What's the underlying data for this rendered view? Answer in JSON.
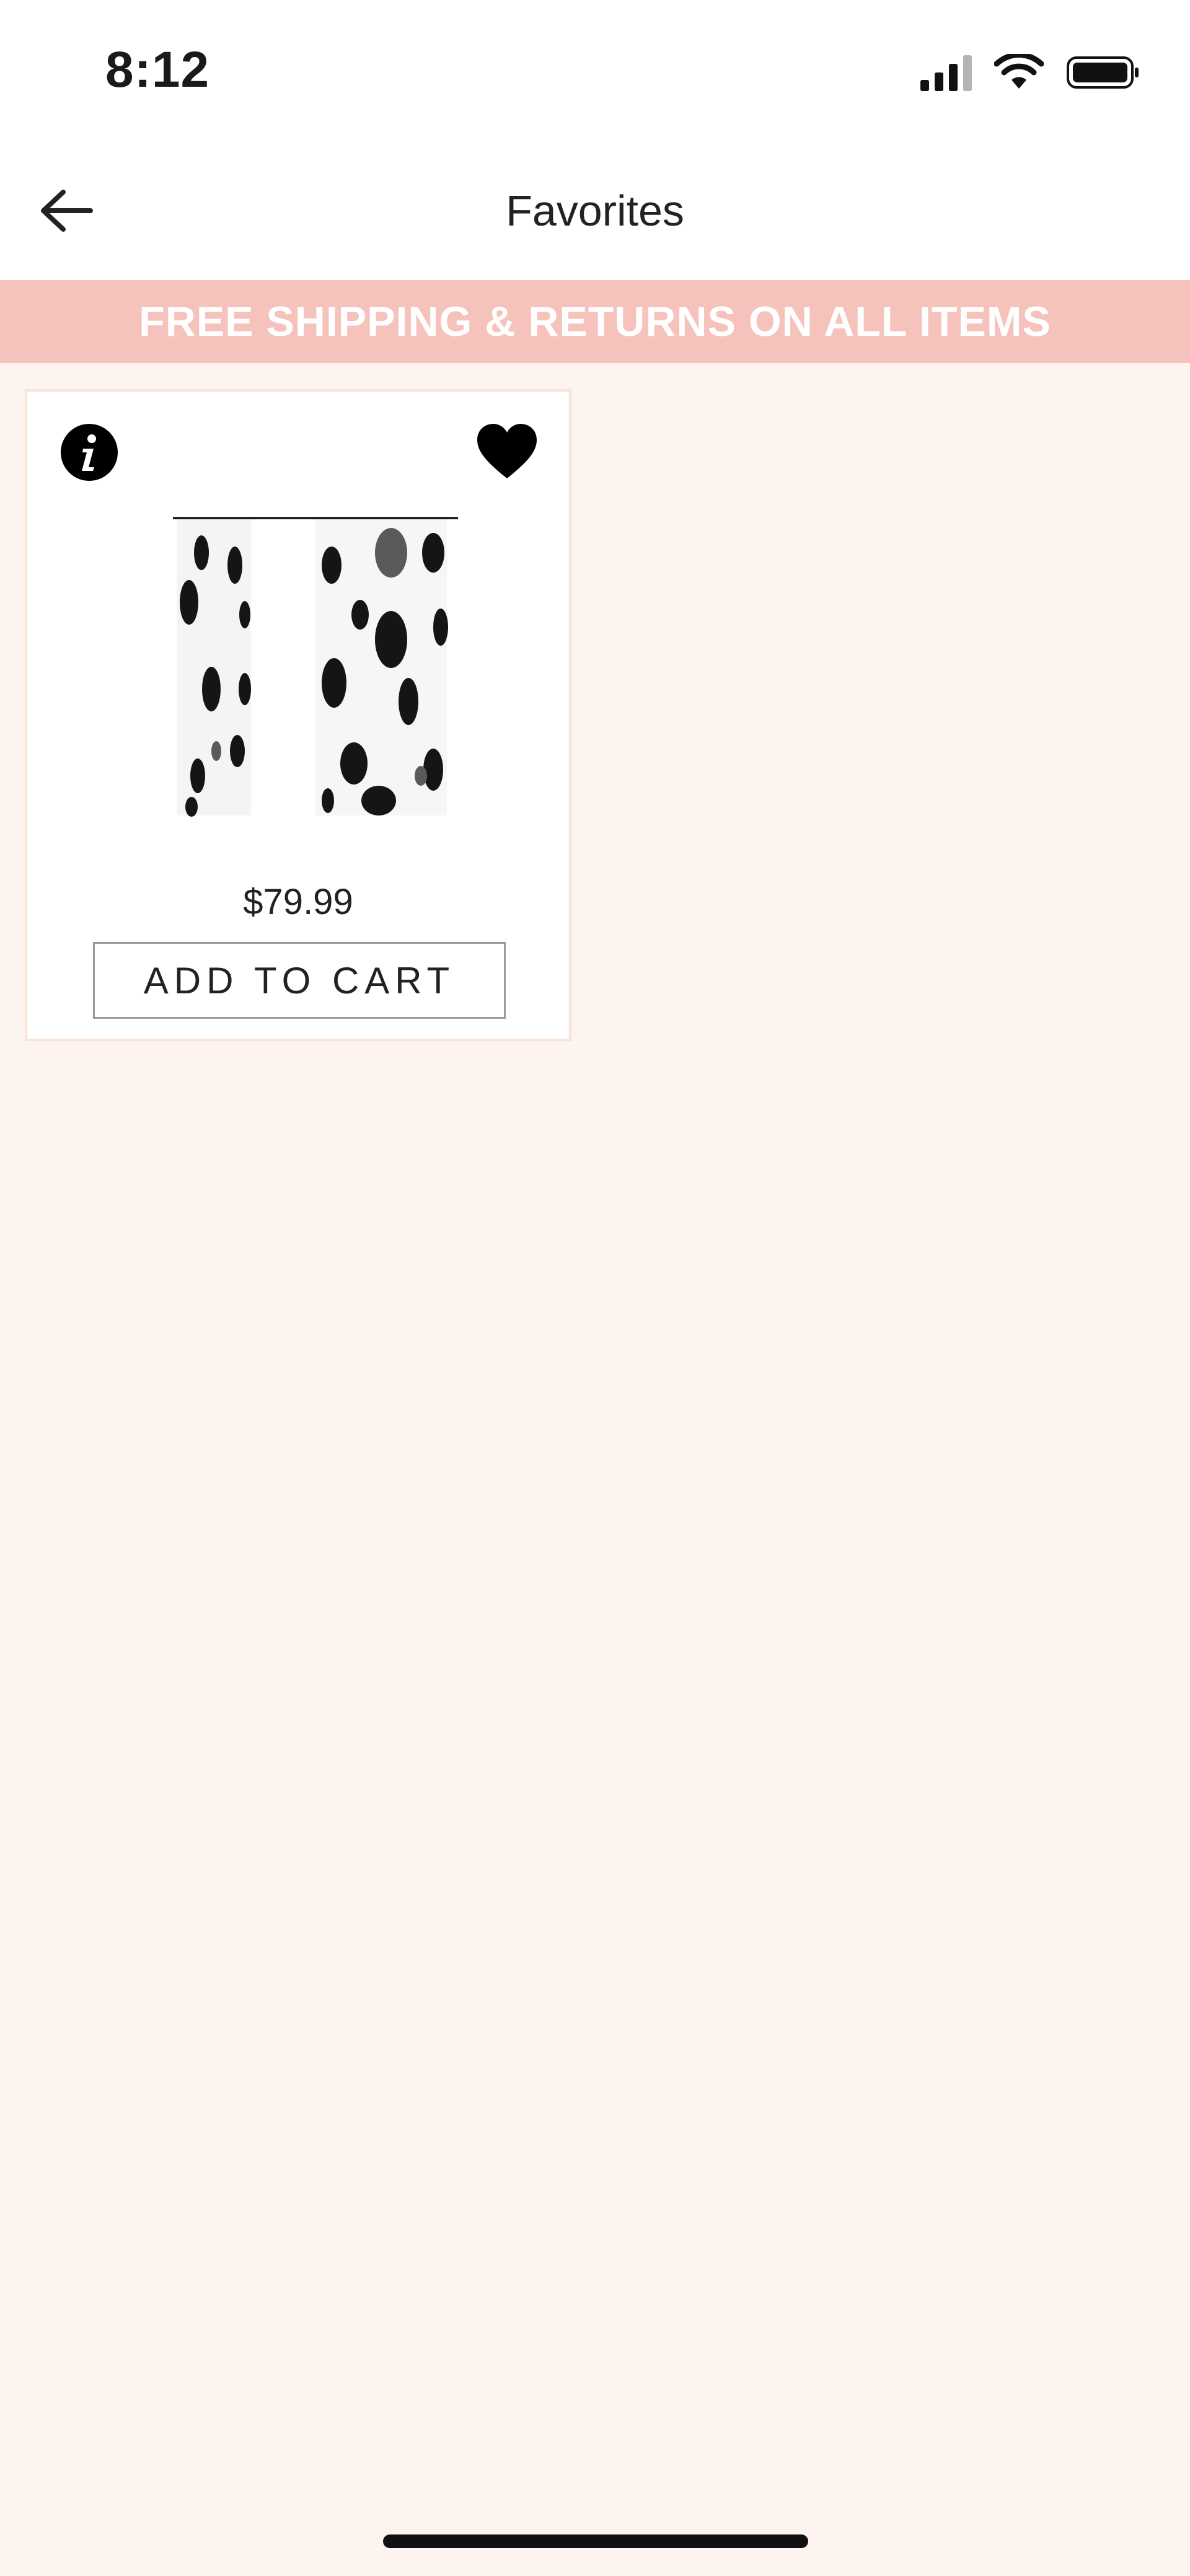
{
  "status_bar": {
    "time": "8:12",
    "icons": [
      "signal-icon",
      "wifi-icon",
      "battery-icon"
    ]
  },
  "nav": {
    "title": "Favorites",
    "back_icon": "arrow-left-icon"
  },
  "promo": {
    "text": "FREE SHIPPING & RETURNS ON ALL ITEMS",
    "background_color": "#f5c3bc"
  },
  "favorites": [
    {
      "price": "$79.99",
      "add_to_cart_label": "ADD TO CART",
      "info_icon": "info-icon",
      "favorite_icon": "heart-filled-icon"
    }
  ],
  "colors": {
    "page_background": "#fdf4ef",
    "card_border": "#f8e4d6",
    "button_border": "#9a9a9a"
  }
}
